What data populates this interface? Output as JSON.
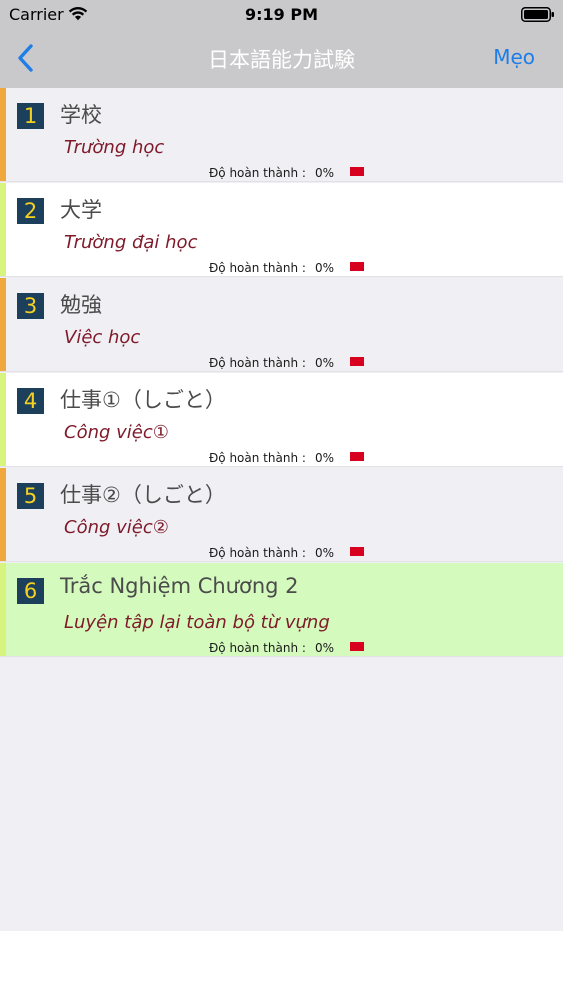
{
  "status_bar": {
    "carrier": "Carrier",
    "time": "9:19 PM"
  },
  "nav": {
    "title": "日本語能力試験",
    "right_button": "Mẹo",
    "back_icon": "chevron-left-icon",
    "accent_color": "#1f7de8"
  },
  "lessons": [
    {
      "number": "1",
      "title": "学校",
      "subtitle": "Trường học",
      "progress_label": "Độ hoàn thành :",
      "progress_value": "0%",
      "background": "#efeff4",
      "accent_color": "#f0a83c"
    },
    {
      "number": "2",
      "title": "大学",
      "subtitle": "Trường đại học",
      "progress_label": "Độ hoàn thành :",
      "progress_value": "0%",
      "background": "#ffffff",
      "accent_color": "#d7f57e"
    },
    {
      "number": "3",
      "title": "勉強",
      "subtitle": "Việc học",
      "progress_label": "Độ hoàn thành :",
      "progress_value": "0%",
      "background": "#efeff4",
      "accent_color": "#f0a83c"
    },
    {
      "number": "4",
      "title": "仕事①（しごと）",
      "subtitle": "Công việc①",
      "progress_label": "Độ hoàn thành :",
      "progress_value": "0%",
      "background": "#ffffff",
      "accent_color": "#d7f57e"
    },
    {
      "number": "5",
      "title": "仕事②（しごと）",
      "subtitle": "Công việc②",
      "progress_label": "Độ hoàn thành :",
      "progress_value": "0%",
      "background": "#efeff4",
      "accent_color": "#f0a83c"
    },
    {
      "number": "6",
      "title": "Trắc Nghiệm Chương 2",
      "subtitle": "Luyện tập lại toàn bộ từ vựng",
      "progress_label": "Độ hoàn thành :",
      "progress_value": "0%",
      "background": "#d4fbbd",
      "accent_color": "#d7f57e"
    }
  ],
  "colors": {
    "number_badge_bg": "#1c3f5c",
    "number_badge_text": "#f4d11f",
    "subtitle_text": "#7f1a2a",
    "progress_marker": "#d8001f"
  }
}
